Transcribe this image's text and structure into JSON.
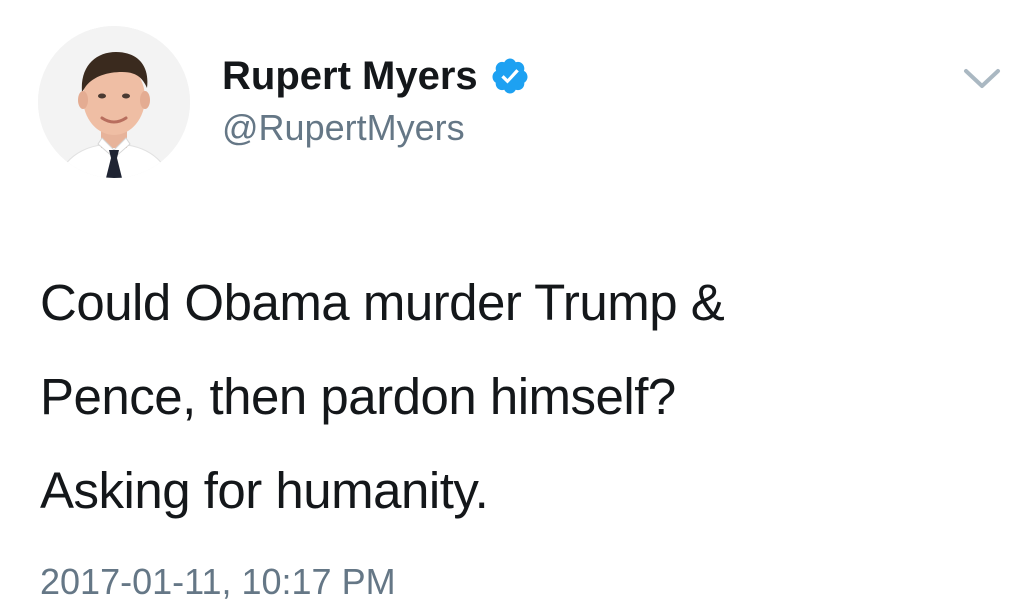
{
  "author": {
    "name": "Rupert Myers",
    "handle": "@RupertMyers",
    "verified": true
  },
  "tweet": {
    "lines": [
      "Could Obama murder Trump &",
      "Pence, then pardon himself?",
      "Asking for humanity."
    ],
    "timestamp": "2017-01-11, 10:17 PM"
  },
  "icons": {
    "verified_badge": "verified-check-icon",
    "menu": "chevron-down-icon"
  },
  "colors": {
    "text": "#14171a",
    "secondary": "#657786",
    "verified_blue": "#1da1f2",
    "chevron": "#aab8c2"
  }
}
